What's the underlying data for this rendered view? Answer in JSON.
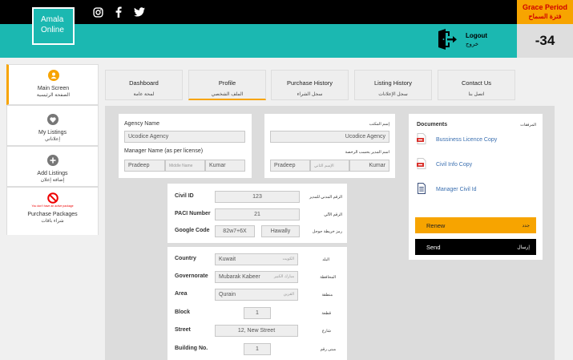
{
  "header": {
    "logo_line1": "Amala",
    "logo_line2": "Online",
    "logout_en": "Logout",
    "logout_ar": "خروج",
    "grace_en": "Grace Period",
    "grace_ar": "فترة السماح",
    "counter": "-34",
    "social_icons": [
      "instagram-icon",
      "facebook-icon",
      "twitter-icon"
    ]
  },
  "sidebar": {
    "items": [
      {
        "en": "Main Screen",
        "ar": "الصفحة الرئيسية",
        "icon": "user-icon"
      },
      {
        "en": "My Listings",
        "ar": "إعلاناتي",
        "icon": "heart-icon"
      },
      {
        "en": "Add Listings",
        "ar": "إضافة إعلان",
        "icon": "plus-icon"
      },
      {
        "en": "Purchase Packages",
        "ar": "شراء باقات",
        "icon": "no-entry-icon",
        "warning": "You don't have an active package"
      }
    ]
  },
  "tabs": [
    {
      "en": "Dashboard",
      "ar": "لمحة عامة"
    },
    {
      "en": "Profile",
      "ar": "الملف الشخصي"
    },
    {
      "en": "Purchase History",
      "ar": "سجل الشراء"
    },
    {
      "en": "Listing History",
      "ar": "سجل الإعلانات"
    },
    {
      "en": "Contact Us",
      "ar": "اتصل بنا"
    }
  ],
  "agency": {
    "name_label": "Agency Name",
    "name_value": "Ucodice Agency",
    "name_label_ar": "إسم المكتب",
    "name_value_ar": "Ucodice Agency",
    "manager_label": "Manager Name (as per license)",
    "manager_label_ar": "اسم المدير بحسب الرخصة",
    "first": "Pradeep",
    "middle_placeholder": "Middle Name",
    "last": "Kumar",
    "first_ar": "Pradeep",
    "middle_placeholder_ar": "الإسم الثاني",
    "last_ar": "Kumar"
  },
  "ids": {
    "civil_label": "Civil ID",
    "civil_ar": "الرقم المدني للمدير",
    "civil_value": "123",
    "paci_label": "PACI Number",
    "paci_ar": "الرقم الآلي",
    "paci_value": "21",
    "google_label": "Google Code",
    "google_ar": "رمز خريطة جوجل",
    "google_value": "82w7+6X",
    "google_area": "Hawally"
  },
  "address": {
    "country_label": "Country",
    "country_ar": "البلد",
    "country_value": "Kuwait",
    "country_value_ar": "الكويت",
    "gov_label": "Governorate",
    "gov_ar": "المحافظة",
    "gov_value": "Mubarak Kabeer",
    "gov_value_ar": "مبارك الكبير",
    "area_label": "Area",
    "area_ar": "منطقة",
    "area_value": "Qurain",
    "area_value_ar": "القرين",
    "block_label": "Block",
    "block_ar": "قطعة",
    "block_value": "1",
    "street_label": "Street",
    "street_ar": "شارع",
    "street_value": "12, New Street",
    "building_label": "Building No.",
    "building_ar": "مبنى رقم",
    "building_value": "1"
  },
  "documents": {
    "title": "Documents",
    "title_ar": "المرفقات",
    "items": [
      "Bussiness Licence Copy",
      "Civil Info Copy",
      "Manager Civil Id"
    ],
    "renew": "Renew",
    "renew_ar": "جدد",
    "send": "Send",
    "send_ar": "إرسال"
  },
  "colors": {
    "teal": "#1bb8b1",
    "orange": "#f7a400",
    "grace_text": "#d00000"
  }
}
